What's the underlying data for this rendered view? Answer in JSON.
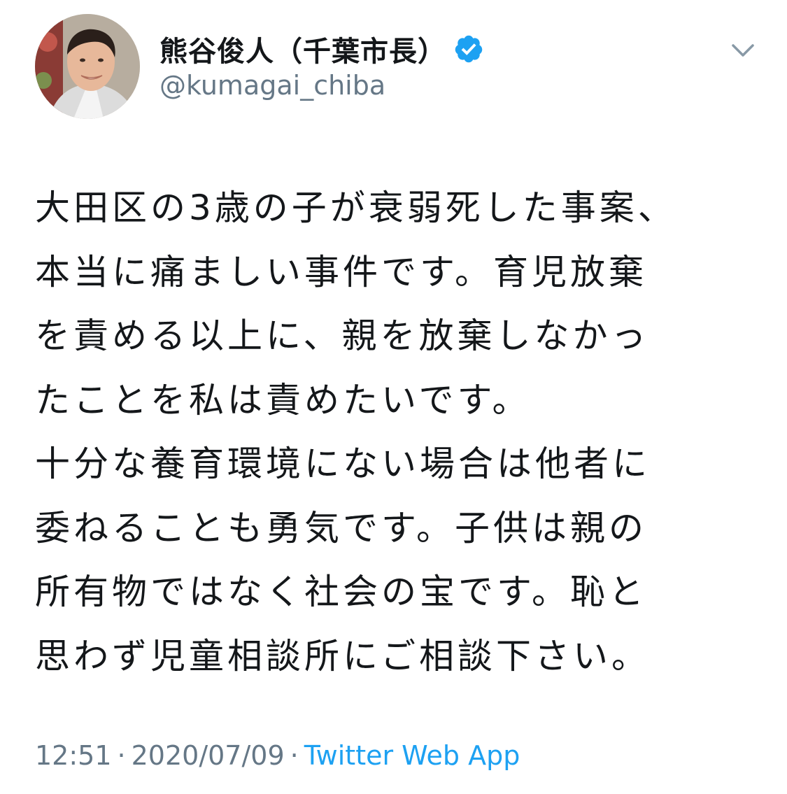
{
  "author": {
    "display_name": "熊谷俊人（千葉市長）",
    "handle": "@kumagai_chiba",
    "verified": true,
    "avatar_icon": "profile-photo",
    "verified_icon": "verified-badge-icon",
    "menu_icon": "chevron-down-icon"
  },
  "tweet": {
    "lines": [
      "大田区の3歳の子が衰弱死した事案、",
      "本当に痛ましい事件です。育児放棄",
      "を責める以上に、親を放棄しなかっ",
      "たことを私は責めたいです。",
      "十分な養育環境にない場合は他者に",
      "委ねることも勇気です。子供は親の",
      "所有物ではなく社会の宝です。恥と",
      "思わず児童相談所にご相談下さい。"
    ]
  },
  "meta": {
    "time": "12:51",
    "separator": "·",
    "date": "2020/07/09",
    "source": "Twitter Web App"
  },
  "colors": {
    "text": "#14171a",
    "secondary": "#657786",
    "accent": "#1da1f2"
  }
}
